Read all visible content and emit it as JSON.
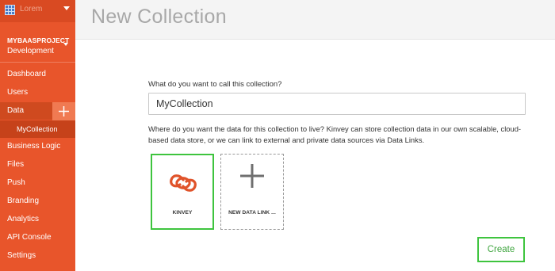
{
  "app": {
    "name": "Lorem",
    "icon": "grid-icon"
  },
  "project": {
    "name": "MYBAASPROJECT",
    "environment": "Development"
  },
  "nav": {
    "items": [
      {
        "label": "Dashboard"
      },
      {
        "label": "Users"
      },
      {
        "label": "Data"
      },
      {
        "label": "Business Logic"
      },
      {
        "label": "Files"
      },
      {
        "label": "Push"
      },
      {
        "label": "Branding"
      },
      {
        "label": "Analytics"
      },
      {
        "label": "API Console"
      },
      {
        "label": "Settings"
      }
    ],
    "active_sub": "MyCollection",
    "add_icon": "plus-icon"
  },
  "header": {
    "title": "New Collection"
  },
  "form": {
    "name_label": "What do you want to call this collection?",
    "name_value": "MyCollection",
    "description": "Where do you want the data for this collection to live? Kinvey can store collection data in our own scalable, cloud-based data store, or we can link to external and private data sources via Data Links.",
    "options": [
      {
        "label": "KINVEY",
        "icon": "kinvey-logo-icon",
        "selected": true
      },
      {
        "label": "NEW DATA LINK ...",
        "icon": "plus-icon",
        "selected": false
      }
    ],
    "create_label": "Create"
  },
  "colors": {
    "sidebar": "#e8552b",
    "accent_green": "#3ec43e",
    "kinvey_logo": "#e0532a"
  }
}
